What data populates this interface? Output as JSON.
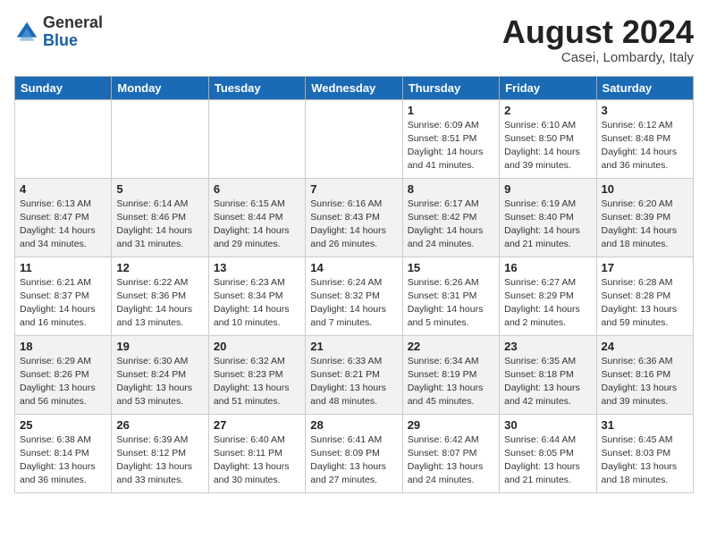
{
  "logo": {
    "general": "General",
    "blue": "Blue"
  },
  "title": {
    "month_year": "August 2024",
    "location": "Casei, Lombardy, Italy"
  },
  "weekdays": [
    "Sunday",
    "Monday",
    "Tuesday",
    "Wednesday",
    "Thursday",
    "Friday",
    "Saturday"
  ],
  "weeks": [
    [
      {
        "day": "",
        "info": ""
      },
      {
        "day": "",
        "info": ""
      },
      {
        "day": "",
        "info": ""
      },
      {
        "day": "",
        "info": ""
      },
      {
        "day": "1",
        "info": "Sunrise: 6:09 AM\nSunset: 8:51 PM\nDaylight: 14 hours\nand 41 minutes."
      },
      {
        "day": "2",
        "info": "Sunrise: 6:10 AM\nSunset: 8:50 PM\nDaylight: 14 hours\nand 39 minutes."
      },
      {
        "day": "3",
        "info": "Sunrise: 6:12 AM\nSunset: 8:48 PM\nDaylight: 14 hours\nand 36 minutes."
      }
    ],
    [
      {
        "day": "4",
        "info": "Sunrise: 6:13 AM\nSunset: 8:47 PM\nDaylight: 14 hours\nand 34 minutes."
      },
      {
        "day": "5",
        "info": "Sunrise: 6:14 AM\nSunset: 8:46 PM\nDaylight: 14 hours\nand 31 minutes."
      },
      {
        "day": "6",
        "info": "Sunrise: 6:15 AM\nSunset: 8:44 PM\nDaylight: 14 hours\nand 29 minutes."
      },
      {
        "day": "7",
        "info": "Sunrise: 6:16 AM\nSunset: 8:43 PM\nDaylight: 14 hours\nand 26 minutes."
      },
      {
        "day": "8",
        "info": "Sunrise: 6:17 AM\nSunset: 8:42 PM\nDaylight: 14 hours\nand 24 minutes."
      },
      {
        "day": "9",
        "info": "Sunrise: 6:19 AM\nSunset: 8:40 PM\nDaylight: 14 hours\nand 21 minutes."
      },
      {
        "day": "10",
        "info": "Sunrise: 6:20 AM\nSunset: 8:39 PM\nDaylight: 14 hours\nand 18 minutes."
      }
    ],
    [
      {
        "day": "11",
        "info": "Sunrise: 6:21 AM\nSunset: 8:37 PM\nDaylight: 14 hours\nand 16 minutes."
      },
      {
        "day": "12",
        "info": "Sunrise: 6:22 AM\nSunset: 8:36 PM\nDaylight: 14 hours\nand 13 minutes."
      },
      {
        "day": "13",
        "info": "Sunrise: 6:23 AM\nSunset: 8:34 PM\nDaylight: 14 hours\nand 10 minutes."
      },
      {
        "day": "14",
        "info": "Sunrise: 6:24 AM\nSunset: 8:32 PM\nDaylight: 14 hours\nand 7 minutes."
      },
      {
        "day": "15",
        "info": "Sunrise: 6:26 AM\nSunset: 8:31 PM\nDaylight: 14 hours\nand 5 minutes."
      },
      {
        "day": "16",
        "info": "Sunrise: 6:27 AM\nSunset: 8:29 PM\nDaylight: 14 hours\nand 2 minutes."
      },
      {
        "day": "17",
        "info": "Sunrise: 6:28 AM\nSunset: 8:28 PM\nDaylight: 13 hours\nand 59 minutes."
      }
    ],
    [
      {
        "day": "18",
        "info": "Sunrise: 6:29 AM\nSunset: 8:26 PM\nDaylight: 13 hours\nand 56 minutes."
      },
      {
        "day": "19",
        "info": "Sunrise: 6:30 AM\nSunset: 8:24 PM\nDaylight: 13 hours\nand 53 minutes."
      },
      {
        "day": "20",
        "info": "Sunrise: 6:32 AM\nSunset: 8:23 PM\nDaylight: 13 hours\nand 51 minutes."
      },
      {
        "day": "21",
        "info": "Sunrise: 6:33 AM\nSunset: 8:21 PM\nDaylight: 13 hours\nand 48 minutes."
      },
      {
        "day": "22",
        "info": "Sunrise: 6:34 AM\nSunset: 8:19 PM\nDaylight: 13 hours\nand 45 minutes."
      },
      {
        "day": "23",
        "info": "Sunrise: 6:35 AM\nSunset: 8:18 PM\nDaylight: 13 hours\nand 42 minutes."
      },
      {
        "day": "24",
        "info": "Sunrise: 6:36 AM\nSunset: 8:16 PM\nDaylight: 13 hours\nand 39 minutes."
      }
    ],
    [
      {
        "day": "25",
        "info": "Sunrise: 6:38 AM\nSunset: 8:14 PM\nDaylight: 13 hours\nand 36 minutes."
      },
      {
        "day": "26",
        "info": "Sunrise: 6:39 AM\nSunset: 8:12 PM\nDaylight: 13 hours\nand 33 minutes."
      },
      {
        "day": "27",
        "info": "Sunrise: 6:40 AM\nSunset: 8:11 PM\nDaylight: 13 hours\nand 30 minutes."
      },
      {
        "day": "28",
        "info": "Sunrise: 6:41 AM\nSunset: 8:09 PM\nDaylight: 13 hours\nand 27 minutes."
      },
      {
        "day": "29",
        "info": "Sunrise: 6:42 AM\nSunset: 8:07 PM\nDaylight: 13 hours\nand 24 minutes."
      },
      {
        "day": "30",
        "info": "Sunrise: 6:44 AM\nSunset: 8:05 PM\nDaylight: 13 hours\nand 21 minutes."
      },
      {
        "day": "31",
        "info": "Sunrise: 6:45 AM\nSunset: 8:03 PM\nDaylight: 13 hours\nand 18 minutes."
      }
    ]
  ]
}
